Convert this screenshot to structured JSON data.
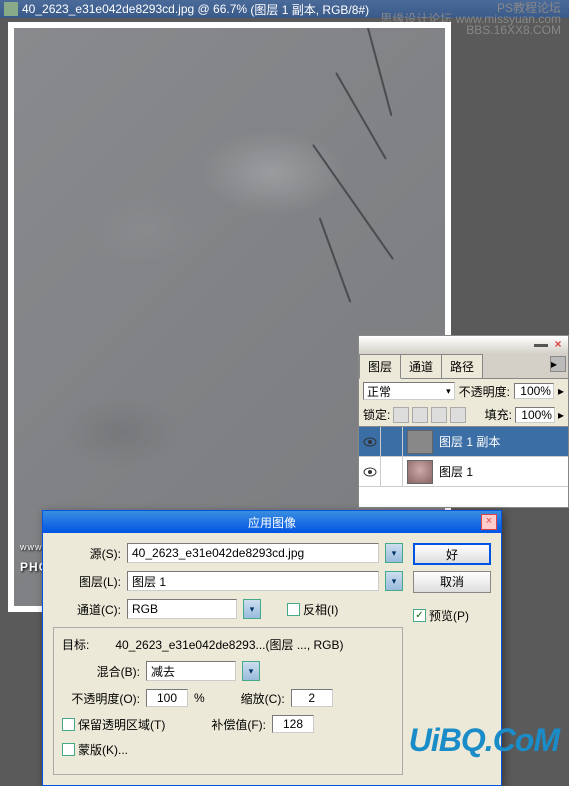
{
  "titlebar": {
    "filename": "40_2623_e31e042de8293cd.jpg",
    "zoom": "66.7%",
    "layer_info": "(图层 1 副本, RGB/8#)"
  },
  "watermark_top": {
    "line1": "PS教程论坛",
    "line2": "思缘设计论坛  www.missyuan.com",
    "line3": "BBS.16XX8.COM"
  },
  "watermark_photo": {
    "small": "www.   照",
    "big": "PHOTOP"
  },
  "layers_panel": {
    "tabs": {
      "layers": "图层",
      "channels": "通道",
      "paths": "路径"
    },
    "blend_mode": "正常",
    "opacity_label": "不透明度:",
    "opacity_value": "100%",
    "lock_label": "锁定:",
    "fill_label": "填充:",
    "fill_value": "100%",
    "layers": [
      {
        "name": "图层 1 副本"
      },
      {
        "name": "图层 1"
      }
    ]
  },
  "apply_image": {
    "title": "应用图像",
    "ok": "好",
    "cancel": "取消",
    "preview_label": "预览(P)",
    "source_label": "源(S):",
    "source_value": "40_2623_e31e042de8293cd.jpg",
    "layer_label": "图层(L):",
    "layer_value": "图层 1",
    "channel_label": "通道(C):",
    "channel_value": "RGB",
    "invert_label": "反相(I)",
    "target_label": "目标:",
    "target_value": "40_2623_e31e042de8293...(图层 ..., RGB)",
    "blend_label": "混合(B):",
    "blend_value": "减去",
    "opacity_label": "不透明度(O):",
    "opacity_value": "100",
    "opacity_pct": "%",
    "preserve_trans_label": "保留透明区域(T)",
    "mask_label": "蒙版(K)...",
    "scale_label": "缩放(C):",
    "scale_value": "2",
    "offset_label": "补偿值(F):",
    "offset_value": "128"
  },
  "uibq": "UiBQ.CoM"
}
